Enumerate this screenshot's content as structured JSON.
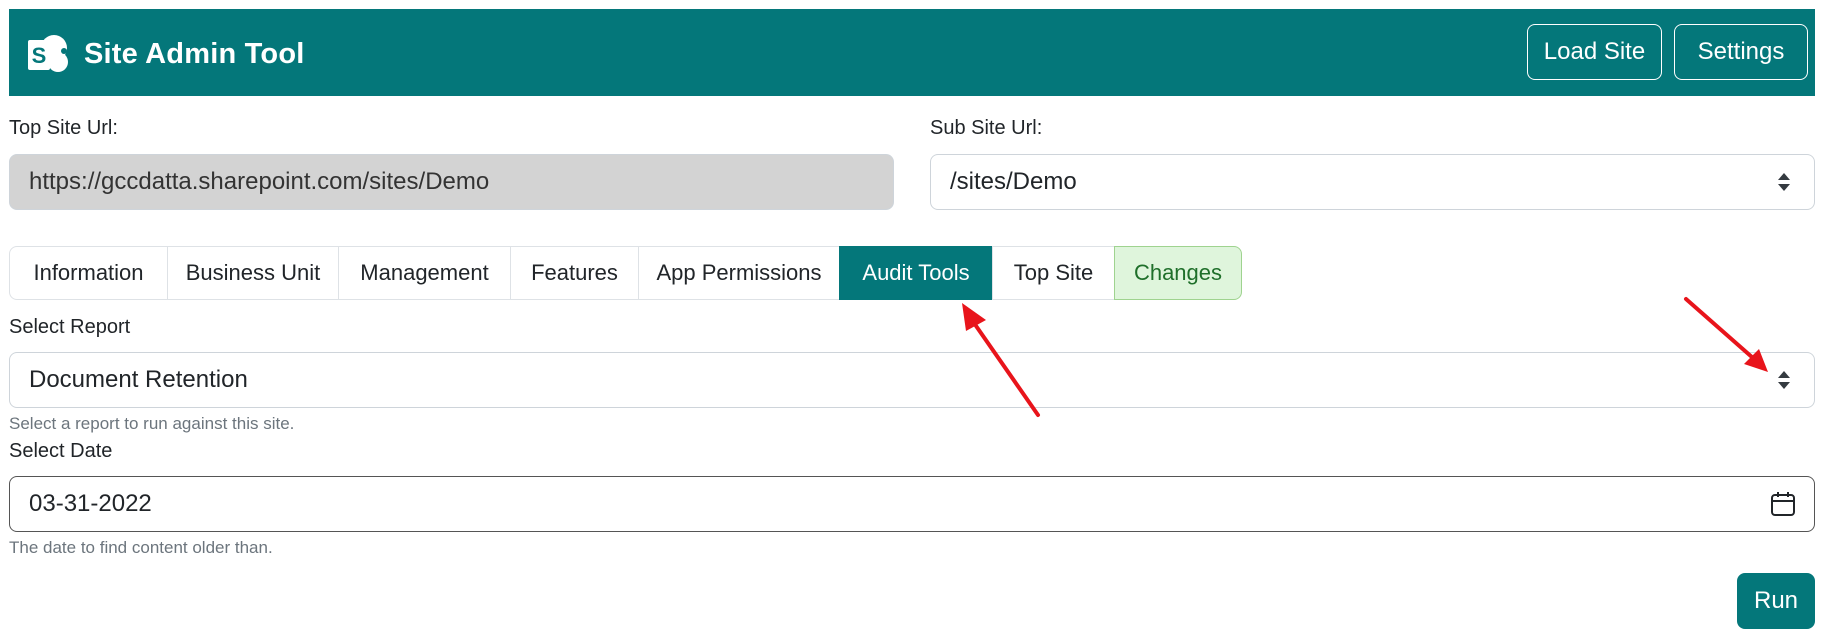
{
  "app": {
    "title": "Site Admin Tool",
    "logo_icon": "sharepoint-logo",
    "accent_color": "#04777a"
  },
  "header": {
    "load_site_label": "Load Site",
    "settings_label": "Settings"
  },
  "top_site": {
    "label": "Top Site Url:",
    "value": "https://gccdatta.sharepoint.com/sites/Demo"
  },
  "sub_site": {
    "label": "Sub Site Url:",
    "value": "/sites/Demo"
  },
  "tabs": [
    {
      "label": "Information"
    },
    {
      "label": "Business Unit"
    },
    {
      "label": "Management"
    },
    {
      "label": "Features"
    },
    {
      "label": "App Permissions"
    },
    {
      "label": "Audit Tools",
      "active": true
    },
    {
      "label": "Top Site"
    },
    {
      "label": "Changes",
      "highlight_color": "#dff5dc"
    }
  ],
  "report": {
    "label": "Select Report",
    "value": "Document Retention",
    "help": "Select a report to run against this site."
  },
  "date": {
    "label": "Select Date",
    "value": "03-31-2022",
    "help": "The date to find content older than."
  },
  "run_label": "Run",
  "annotation_color": "#e8141b"
}
